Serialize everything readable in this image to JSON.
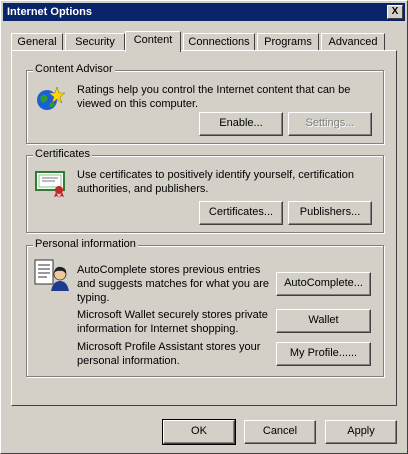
{
  "window": {
    "title": "Internet Options",
    "close_glyph": "X"
  },
  "tabs": [
    {
      "label": "General"
    },
    {
      "label": "Security"
    },
    {
      "label": "Content"
    },
    {
      "label": "Connections"
    },
    {
      "label": "Programs"
    },
    {
      "label": "Advanced"
    }
  ],
  "content_advisor": {
    "title": "Content Advisor",
    "description": "Ratings help you control the Internet content that can be viewed on this computer.",
    "enable_label": "Enable...",
    "settings_label": "Settings..."
  },
  "certificates": {
    "title": "Certificates",
    "description": "Use certificates to positively identify yourself, certification authorities, and publishers.",
    "certificates_label": "Certificates...",
    "publishers_label": "Publishers..."
  },
  "personal": {
    "title": "Personal information",
    "autocomplete_text": "AutoComplete stores previous entries and suggests matches for what you are typing.",
    "autocomplete_label": "AutoComplete...",
    "wallet_text": "Microsoft Wallet securely stores private information for Internet shopping.",
    "wallet_label": "Wallet",
    "profile_text": "Microsoft Profile Assistant stores your personal information.",
    "profile_label": "My Profile......"
  },
  "footer": {
    "ok_label": "OK",
    "cancel_label": "Cancel",
    "apply_label": "Apply"
  }
}
